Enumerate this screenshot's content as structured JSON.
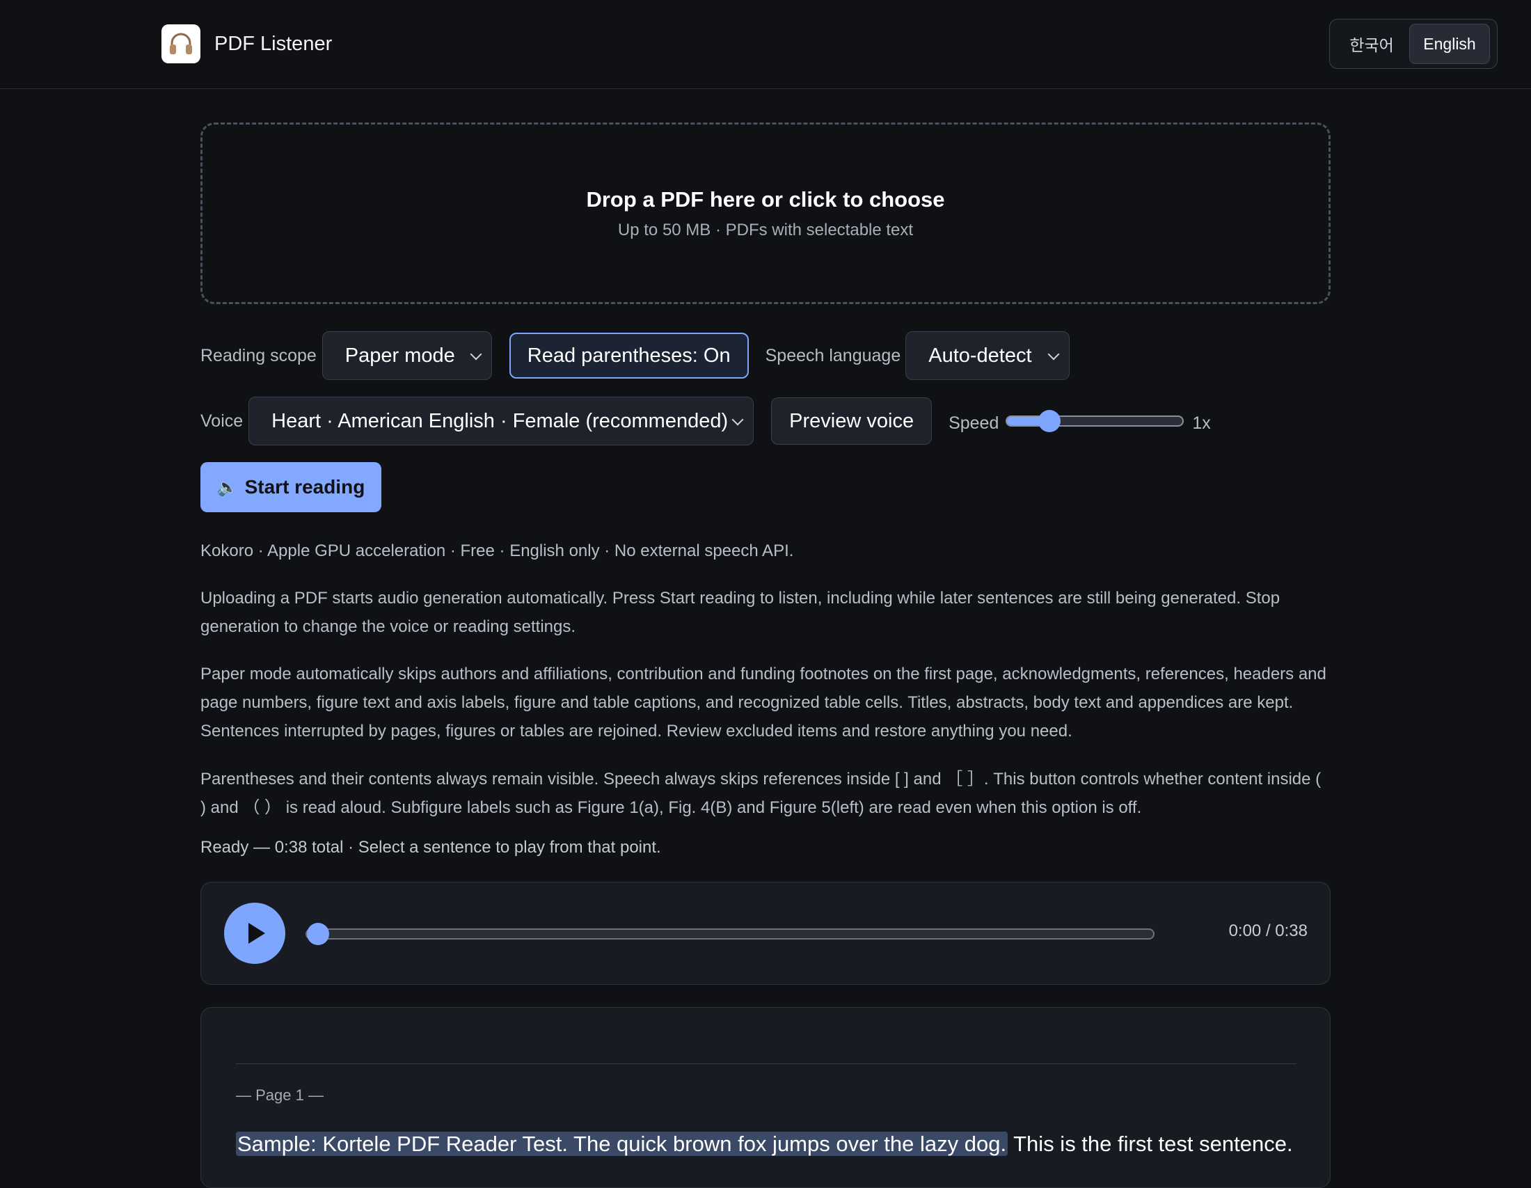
{
  "app": {
    "title": "PDF Listener",
    "logo_icon": "headphones-icon"
  },
  "language_switch": {
    "options": [
      "한국어",
      "English"
    ],
    "selected": "English"
  },
  "dropzone": {
    "title": "Drop a PDF here or click to choose",
    "subtitle": "Up to 50 MB · PDFs with selectable text"
  },
  "controls": {
    "reading_scope_label": "Reading scope",
    "reading_scope_value": "Paper mode",
    "parentheses_button": "Read parentheses: On",
    "speech_language_label": "Speech language",
    "speech_language_value": "Auto-detect",
    "voice_label": "Voice",
    "voice_value": "Heart · American English · Female (recommended)",
    "preview_button": "Preview voice",
    "speed_label": "Speed",
    "speed_value": "1x",
    "speed_fraction": 0.24,
    "start_button": "Start reading",
    "start_icon": "speaker-icon"
  },
  "info": {
    "engine": "Kokoro · Apple GPU acceleration · Free · English only · No external speech API.",
    "auto_generation": "Uploading a PDF starts audio generation automatically. Press Start reading to listen, including while later sentences are still being generated. Stop generation to change the voice or reading settings.",
    "paper_mode": "Paper mode automatically skips authors and affiliations, contribution and funding footnotes on the first page, acknowledgments, references, headers and page numbers, figure text and axis labels, figure and table captions, and recognized table cells. Titles, abstracts, body text and appendices are kept. Sentences interrupted by pages, figures or tables are rejoined. Review excluded items and restore anything you need.",
    "parentheses": "Parentheses and their contents always remain visible. Speech always skips references inside [ ] and ［ ］. This button controls whether content inside ( ) and （ ） is read aloud. Subfigure labels such as Figure 1(a), Fig. 4(B) and Figure 5(left) are read even when this option is off."
  },
  "status": "Ready — 0:38 total · Select a sentence to play from that point.",
  "player": {
    "time": "0:00 / 0:38",
    "progress_fraction": 0.0
  },
  "reader": {
    "page_marker": "— Page 1 —",
    "highlighted_sentence": "Sample: Kortele PDF Reader Test. The quick brown fox jumps over the lazy dog.",
    "next_sentence": "This is the first test sentence."
  },
  "colors": {
    "accent": "#7ea6ff",
    "background": "#0f1115",
    "panel": "#181b22"
  }
}
